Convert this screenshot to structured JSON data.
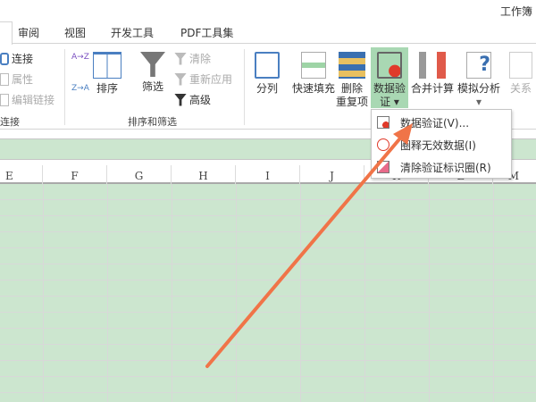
{
  "window": {
    "title": "工作簿"
  },
  "tabs": [
    "审阅",
    "视图",
    "开发工具",
    "PDF工具集"
  ],
  "ribbon": {
    "connections": {
      "items": [
        "连接",
        "属性",
        "编辑链接"
      ],
      "group": "连接"
    },
    "sort_filter": {
      "sort_az": "A→Z",
      "sort_za": "Z→A",
      "sort": "排序",
      "filter": "筛选",
      "clear": "清除",
      "reapply": "重新应用",
      "advanced": "高级",
      "group": "排序和筛选"
    },
    "data_tools": {
      "text_to_columns": "分列",
      "flash_fill": "快速填充",
      "remove_dup_1": "删除",
      "remove_dup_2": "重复项",
      "data_validation_1": "数据验",
      "data_validation_2": "证 ▾",
      "consolidate": "合并计算",
      "what_if": "模拟分析",
      "what_if_arrow": "▾",
      "relationships": "关系"
    }
  },
  "dropdown": {
    "items": [
      "数据验证(V)...",
      "圈释无效数据(I)",
      "清除验证标识圈(R)"
    ]
  },
  "columns": [
    "E",
    "F",
    "G",
    "H",
    "I",
    "J",
    "K",
    "L",
    "M"
  ],
  "colors": {
    "accent": "#217346",
    "arrow": "#f07448",
    "grid": "#cce6cf"
  }
}
